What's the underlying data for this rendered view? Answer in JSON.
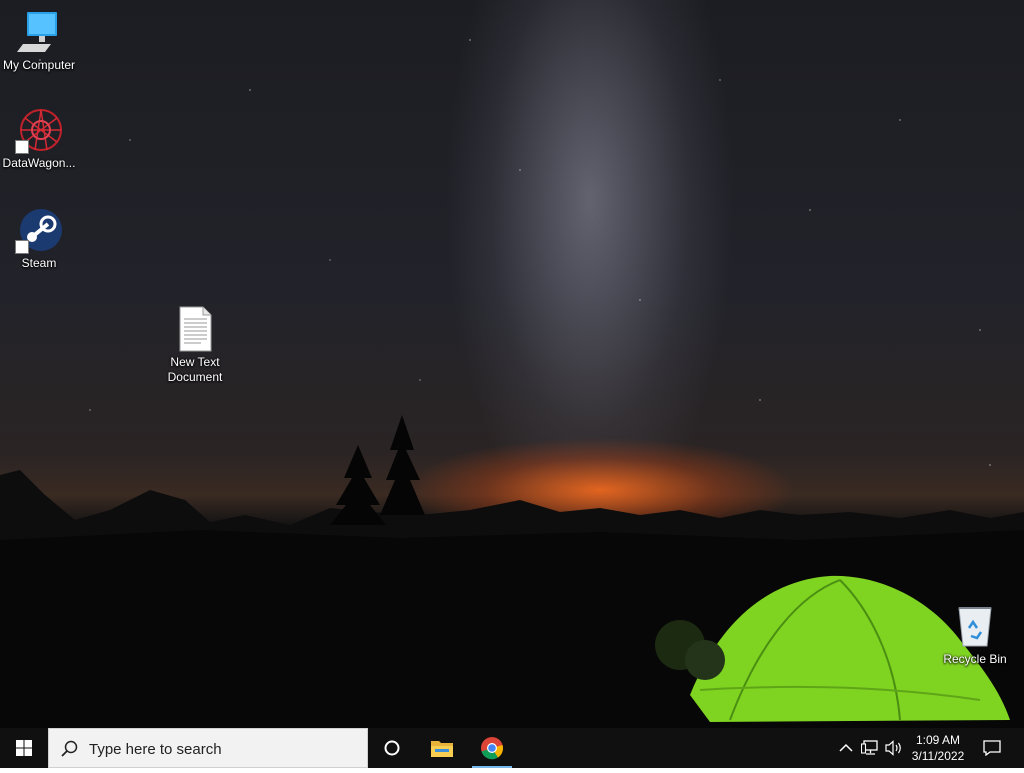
{
  "desktop": {
    "icons": [
      {
        "label": "My Computer",
        "icon": "computer-icon"
      },
      {
        "label": "DataWagon...",
        "icon": "datawagon-icon"
      },
      {
        "label": "Steam",
        "icon": "steam-icon"
      },
      {
        "label": "New Text Document",
        "icon": "text-document-icon"
      },
      {
        "label": "Recycle Bin",
        "icon": "recycle-bin-icon"
      }
    ]
  },
  "taskbar": {
    "search_placeholder": "Type here to search",
    "pinned": [
      {
        "name": "cortana",
        "icon": "cortana-circle-icon"
      },
      {
        "name": "file-explorer",
        "icon": "folder-icon"
      },
      {
        "name": "chrome",
        "icon": "chrome-icon",
        "active": true
      }
    ],
    "tray": {
      "time": "1:09 AM",
      "date": "3/11/2022",
      "icons": [
        "chevron-up-icon",
        "network-icon",
        "volume-icon",
        "notification-icon"
      ]
    },
    "accent_color": "#76b9ed"
  }
}
